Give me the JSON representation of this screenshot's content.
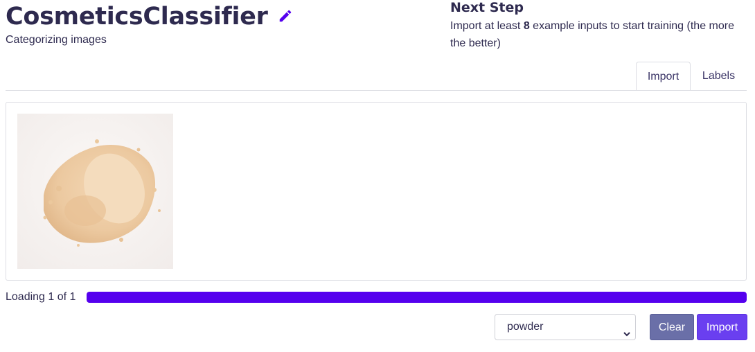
{
  "header": {
    "title": "CosmeticsClassifier",
    "subtitle": "Categorizing images",
    "edit_icon": "pencil-icon"
  },
  "next_step": {
    "heading": "Next Step",
    "text_before": "Import at least ",
    "count": "8",
    "text_after": " example inputs to start training (the more the better)"
  },
  "tabs": [
    {
      "label": "Import",
      "active": true
    },
    {
      "label": "Labels",
      "active": false
    }
  ],
  "gallery": {
    "items": [
      {
        "subject": "loose beige face powder on white background"
      }
    ]
  },
  "progress": {
    "label": "Loading 1 of 1",
    "fraction": 1.0,
    "color": "#5500ee"
  },
  "controls": {
    "label_select_value": "powder",
    "clear_label": "Clear",
    "import_label": "Import"
  },
  "colors": {
    "text": "#2e2a4f",
    "accent": "#5500ee",
    "clear_button": "#6a6fa8",
    "import_button": "#6a3ff0"
  }
}
